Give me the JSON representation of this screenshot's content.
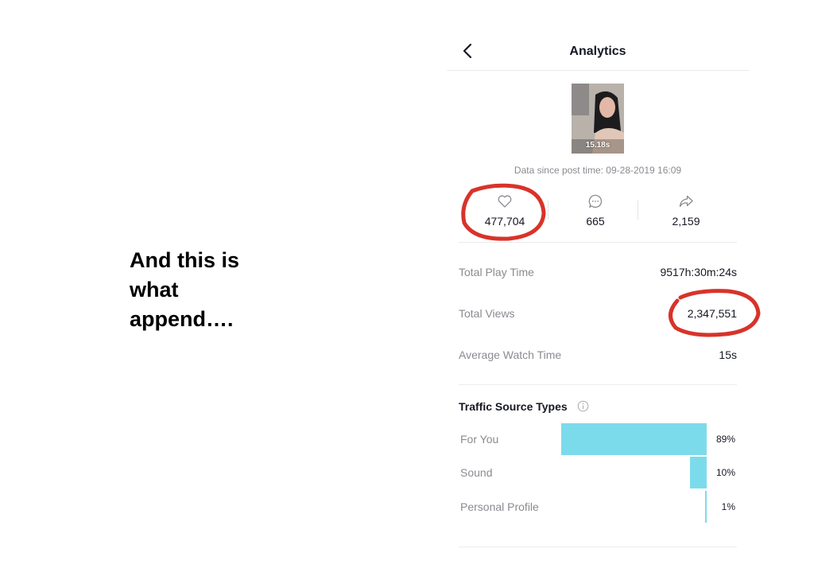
{
  "caption": "And this is\nwhat\nappend….",
  "header": {
    "title": "Analytics"
  },
  "video": {
    "duration": "15.18s"
  },
  "data_since": "Data since post time: 09-28-2019 16:09",
  "stats": {
    "likes": "477,704",
    "comments": "665",
    "shares": "2,159"
  },
  "metrics": [
    {
      "label": "Total Play Time",
      "value": "9517h:30m:24s"
    },
    {
      "label": "Total Views",
      "value": "2,347,551"
    },
    {
      "label": "Average Watch Time",
      "value": "15s"
    }
  ],
  "traffic": {
    "heading": "Traffic Source Types",
    "bar_color": "#7cdbeb",
    "sources": [
      {
        "label": "For You",
        "pct_label": "89%",
        "share": 0.89
      },
      {
        "label": "Sound",
        "pct_label": "10%",
        "share": 0.1
      },
      {
        "label": "Personal Profile",
        "pct_label": "1%",
        "share": 0.01
      }
    ]
  },
  "annotation_color": "#d8332a",
  "icons": {
    "back": "chevron-left-icon",
    "likes": "heart-icon",
    "comments": "comment-icon",
    "shares": "share-icon",
    "info": "info-icon"
  }
}
